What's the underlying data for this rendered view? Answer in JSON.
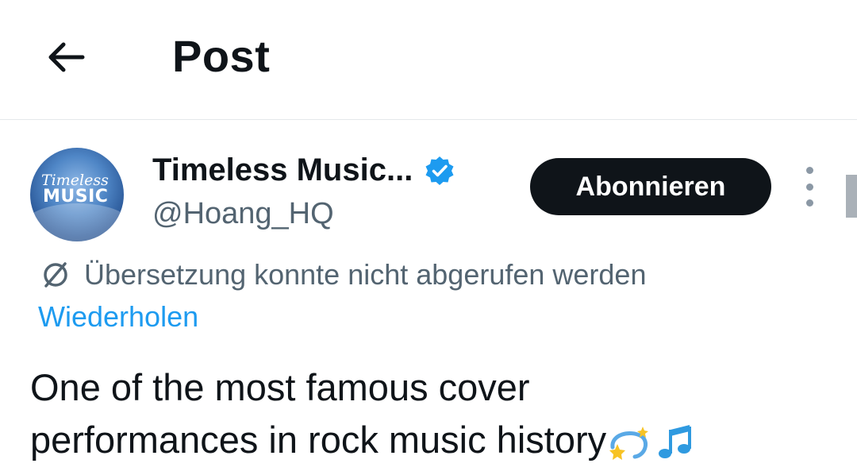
{
  "header": {
    "title": "Post"
  },
  "author": {
    "display_name": "Timeless Music...",
    "handle": "@Hoang_HQ",
    "avatar_text_top": "Timeless",
    "avatar_text_bottom": "MUSIC",
    "verified": true
  },
  "subscribe_label": "Abonnieren",
  "translation": {
    "error_text": "Übersetzung konnte nicht abgerufen werden",
    "retry_label": "Wiederholen"
  },
  "tweet": {
    "line1": "One of the most famous cover",
    "line2": "performances in rock music history"
  },
  "colors": {
    "accent": "#1d9bf0",
    "text": "#0f1419",
    "secondary": "#536471"
  },
  "icons": [
    "back-arrow-icon",
    "verified-badge-icon",
    "more-options-icon",
    "translate-unavailable-icon",
    "dizzy-emoji-icon",
    "music-notes-emoji-icon"
  ]
}
